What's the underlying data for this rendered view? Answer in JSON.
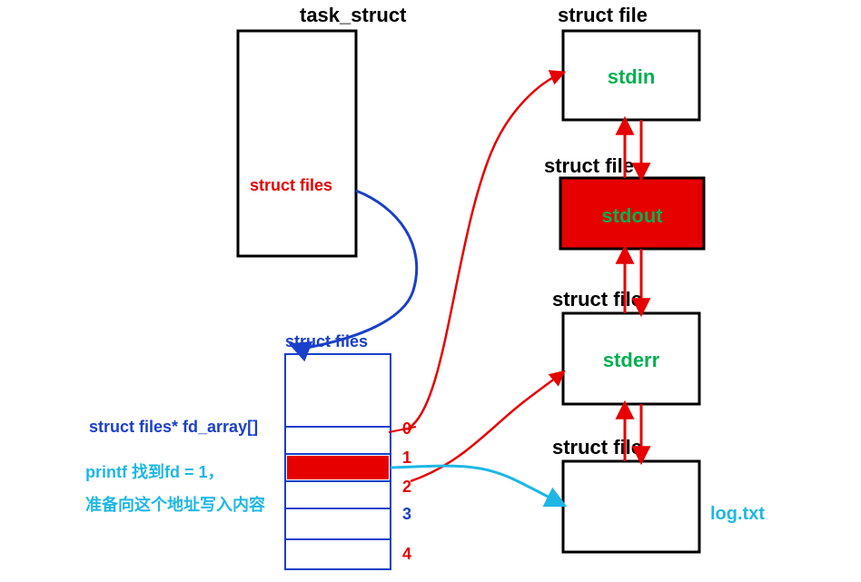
{
  "labels": {
    "task_struct": "task_struct",
    "struct_files_inner": "struct files",
    "struct_files_title": "struct files",
    "fd_array_label": "struct files* fd_array[]",
    "printf_line1": "printf 找到fd = 1，",
    "printf_line2": "准备向这个地址写入内容",
    "struct_file_1": "struct file",
    "struct_file_2": "struct file",
    "struct_file_3": "struct file",
    "struct_file_4": "struct file",
    "stdin": "stdin",
    "stdout": "stdout",
    "stderr": "stderr",
    "logtxt": "log.txt",
    "idx0": "0",
    "idx1": "1",
    "idx2": "2",
    "idx3": "3",
    "idx4": "4"
  },
  "colors": {
    "black": "#000000",
    "red": "#e60000",
    "blue": "#1a3fca",
    "green": "#00b050",
    "cyan": "#1db7e6",
    "red_fill": "#e60000",
    "white": "#ffffff"
  }
}
